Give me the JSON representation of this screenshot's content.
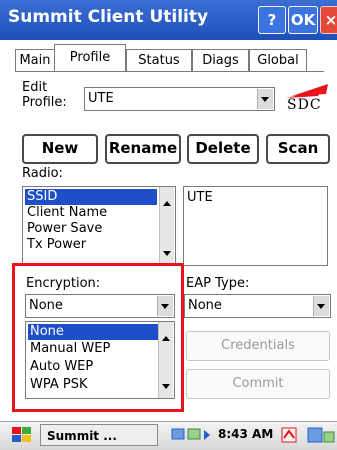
{
  "window": {
    "title": "Summit Client Utility",
    "help_label": "?",
    "ok_label": "OK",
    "close_label": "×"
  },
  "tabs": [
    {
      "label": "Main"
    },
    {
      "label": "Profile",
      "active": true
    },
    {
      "label": "Status"
    },
    {
      "label": "Diags"
    },
    {
      "label": "Global"
    }
  ],
  "profile": {
    "edit_label_line1": "Edit",
    "edit_label_line2": "Profile:",
    "selected": "UTE",
    "logo_text": "SDC"
  },
  "buttons": {
    "new": "New",
    "rename": "Rename",
    "delete": "Delete",
    "scan": "Scan"
  },
  "radio": {
    "label": "Radio:",
    "items": [
      "SSID",
      "Client Name",
      "Power Save",
      "Tx Power"
    ],
    "selected_index": 0,
    "value": "UTE"
  },
  "encryption": {
    "label": "Encryption:",
    "selected": "None",
    "options": [
      "None",
      "Manual WEP",
      "Auto WEP",
      "WPA PSK"
    ]
  },
  "eap": {
    "label": "EAP Type:",
    "selected": "None",
    "credentials_label": "Credentials",
    "commit_label": "Commit"
  },
  "taskbar": {
    "task_label": "Summit ...",
    "time": "8:43 AM"
  },
  "colors": {
    "titlebar": "#2a5cc8",
    "selection": "#1e4fc8",
    "highlight": "#e8141c"
  }
}
